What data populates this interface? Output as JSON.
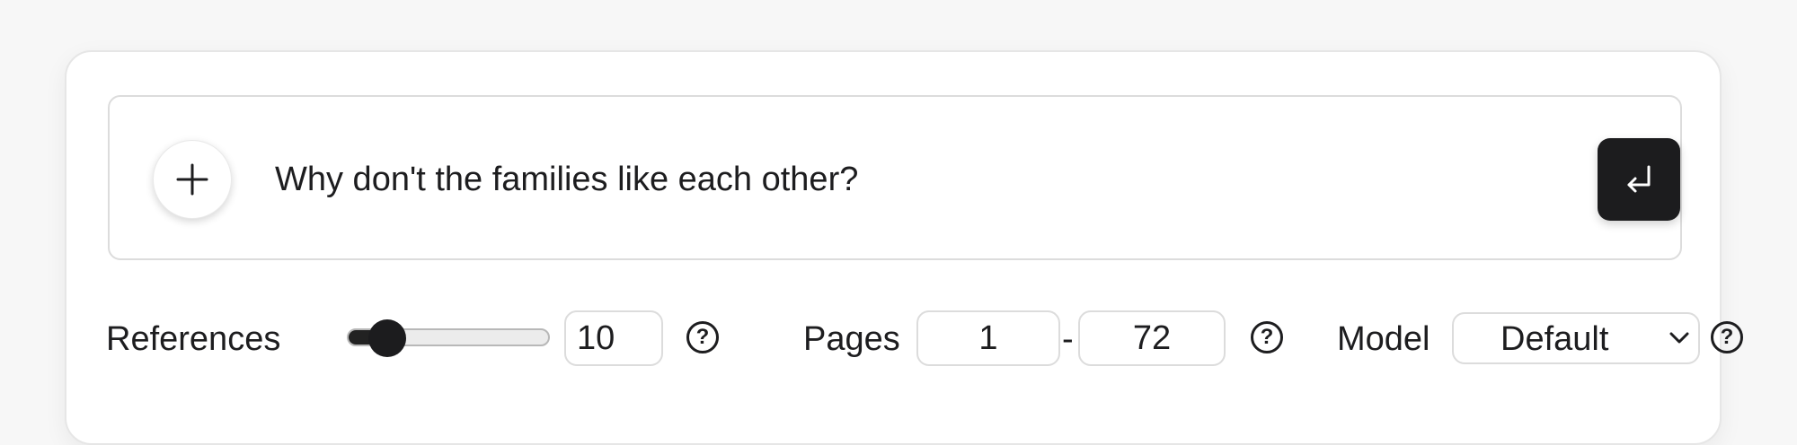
{
  "query": {
    "add_icon": "plus-icon",
    "value": "Why don't the families like each other?",
    "submit_icon": "return-arrow-icon"
  },
  "controls": {
    "references": {
      "label": "References",
      "value": "10",
      "slider_fraction": 0.2,
      "help_icon": "question-circle-icon"
    },
    "pages": {
      "label": "Pages",
      "from": "1",
      "separator": "-",
      "to": "72",
      "help_icon": "question-circle-icon"
    },
    "model": {
      "label": "Model",
      "selected": "Default",
      "dropdown_icon": "chevron-down-icon",
      "help_icon": "question-circle-icon"
    }
  },
  "colors": {
    "accent": "#1c1c1e",
    "border": "#dcdcdc",
    "background": "#f7f7f7"
  }
}
